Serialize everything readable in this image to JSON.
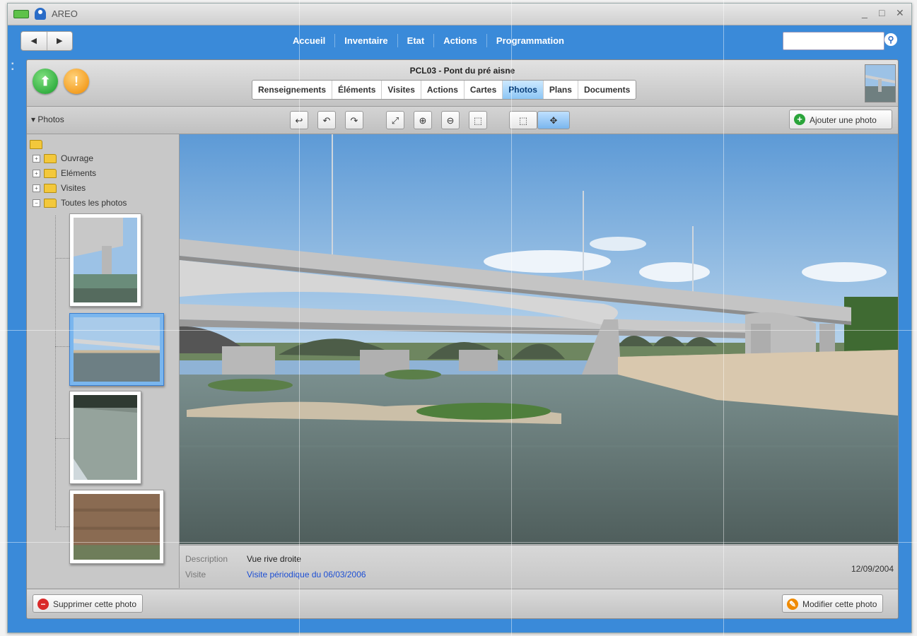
{
  "window": {
    "app_name": "AREO",
    "controls": [
      "_",
      "□",
      "✕"
    ]
  },
  "nav": {
    "back": "◀",
    "forward": "▶",
    "menu": [
      "Accueil",
      "Inventaire",
      "Etat",
      "Actions",
      "Programmation"
    ],
    "search_placeholder": ""
  },
  "object": {
    "title": "PCL03 - Pont du pré aisne",
    "tabs": [
      "Renseignements",
      "Éléments",
      "Visites",
      "Actions",
      "Cartes",
      "Photos",
      "Plans",
      "Documents"
    ],
    "active_tab": "Photos"
  },
  "toolbar": {
    "section_label": "▾ Photos",
    "buttons": [
      "↩",
      "↶",
      "↷",
      "⤢",
      "⊕",
      "⊖",
      "⬚",
      "⬚",
      "✥"
    ],
    "add_photo_label": "Ajouter une photo"
  },
  "tree": {
    "items": [
      "Ouvrage",
      "Eléments",
      "Visites",
      "Toutes les photos"
    ]
  },
  "info": {
    "description_label": "Description",
    "description_value": "Vue rive droite",
    "visit_label": "Visite",
    "visit_value": "Visite périodique du 06/03/2006",
    "date": "12/09/2004"
  },
  "footer": {
    "delete_label": "Supprimer cette photo",
    "edit_label": "Modifier cette photo"
  },
  "colors": {
    "window_blue": "#3a8ad9",
    "status_green": "#179c2a",
    "status_orange": "#ef8a00",
    "link_blue": "#1d4fd4"
  }
}
